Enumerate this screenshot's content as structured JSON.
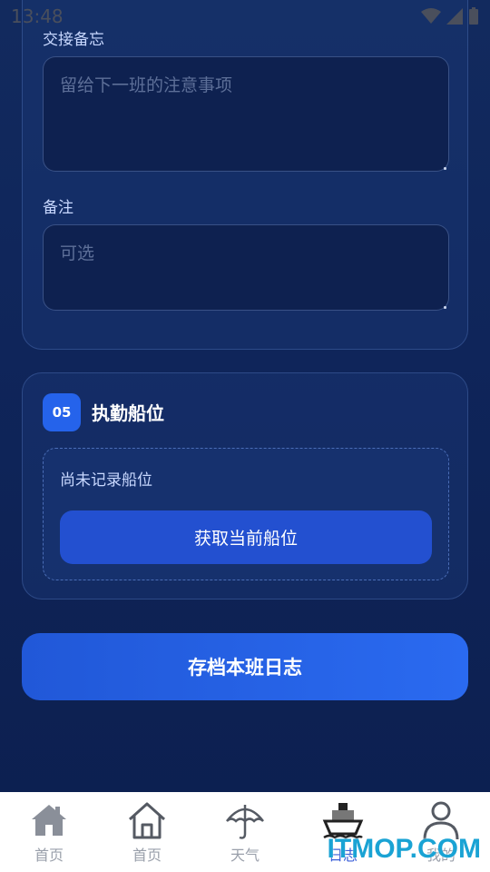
{
  "status_bar": {
    "time": "13:48"
  },
  "handover_field": {
    "label": "交接备忘",
    "placeholder": "留给下一班的注意事项"
  },
  "remarks_field": {
    "label": "备注",
    "placeholder": "可选"
  },
  "position_section": {
    "step": "05",
    "title": "执勤船位",
    "empty_text": "尚未记录船位",
    "button_label": "获取当前船位"
  },
  "save_button_label": "存档本班日志",
  "tabs": [
    {
      "label": "首页",
      "icon": "house-filled-icon",
      "active": false
    },
    {
      "label": "首页",
      "icon": "house-outline-icon",
      "active": false
    },
    {
      "label": "天气",
      "icon": "umbrella-icon",
      "active": false
    },
    {
      "label": "日志",
      "icon": "ship-icon",
      "active": true
    },
    {
      "label": "我的",
      "icon": "person-icon",
      "active": false
    }
  ],
  "colors": {
    "accent": "#2563eb",
    "background": "#0f255a",
    "active_tab": "#3b5fd8"
  },
  "watermark": "ITMOP.COM"
}
